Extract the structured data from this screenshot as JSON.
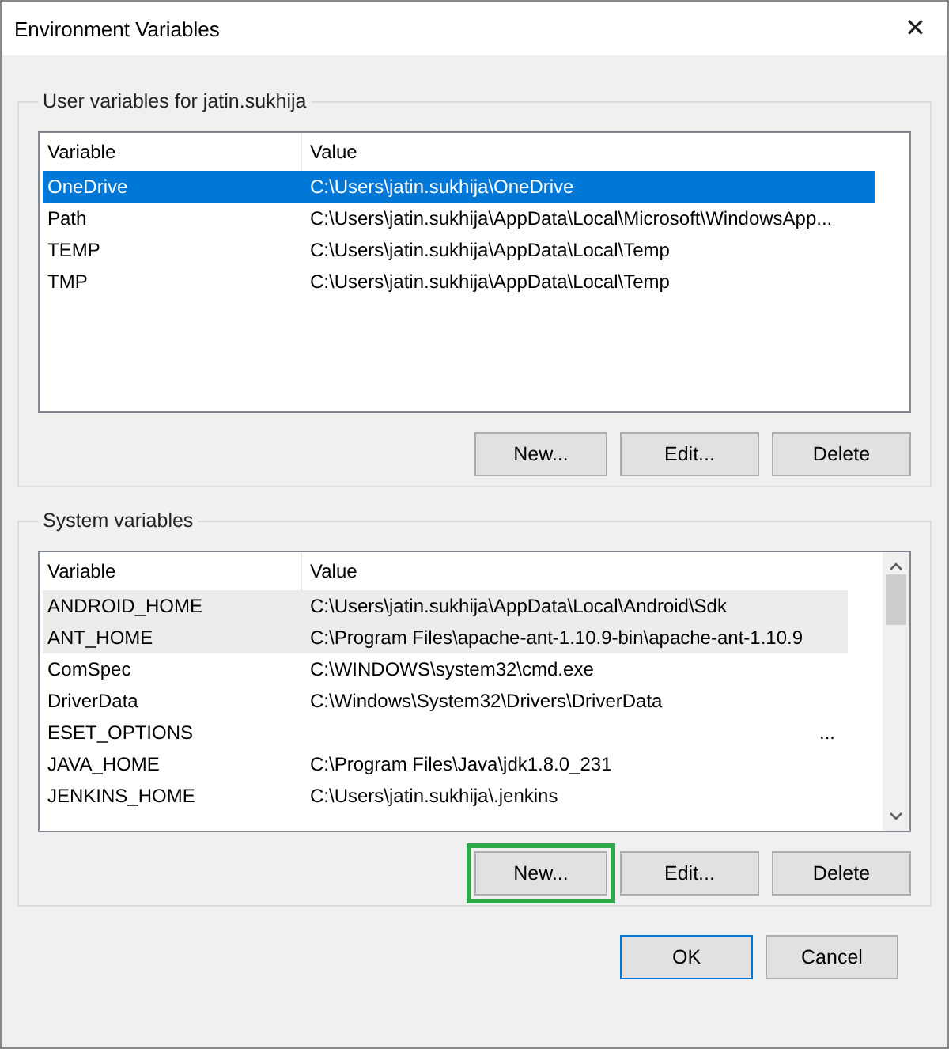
{
  "window": {
    "title": "Environment Variables",
    "close": "✕"
  },
  "user_group": {
    "title": "User variables for jatin.sukhija",
    "columns": [
      "Variable",
      "Value"
    ],
    "rows": [
      {
        "variable": "OneDrive",
        "value": "C:\\Users\\jatin.sukhija\\OneDrive",
        "selected": true
      },
      {
        "variable": "Path",
        "value": "C:\\Users\\jatin.sukhija\\AppData\\Local\\Microsoft\\WindowsApp...",
        "selected": false
      },
      {
        "variable": "TEMP",
        "value": "C:\\Users\\jatin.sukhija\\AppData\\Local\\Temp",
        "selected": false
      },
      {
        "variable": "TMP",
        "value": "C:\\Users\\jatin.sukhija\\AppData\\Local\\Temp",
        "selected": false
      }
    ],
    "buttons": [
      {
        "label": "New...",
        "highlighted": false
      },
      {
        "label": "Edit...",
        "highlighted": false
      },
      {
        "label": "Delete",
        "highlighted": false
      }
    ]
  },
  "system_group": {
    "title": "System variables",
    "columns": [
      "Variable",
      "Value"
    ],
    "rows": [
      {
        "variable": "ANDROID_HOME",
        "value": "C:\\Users\\jatin.sukhija\\AppData\\Local\\Android\\Sdk",
        "selected": true,
        "kind": "plain"
      },
      {
        "variable": "ANT_HOME",
        "value": "C:\\Program Files\\apache-ant-1.10.9-bin\\apache-ant-1.10.9",
        "selected": true,
        "kind": "plain"
      },
      {
        "variable": "ComSpec",
        "value": "C:\\WINDOWS\\system32\\cmd.exe",
        "selected": false,
        "kind": "plain"
      },
      {
        "variable": "DriverData",
        "value": "C:\\Windows\\System32\\Drivers\\DriverData",
        "selected": false,
        "kind": "plain"
      },
      {
        "variable": "ESET_OPTIONS",
        "value": "...",
        "selected": false,
        "kind": "overflow"
      },
      {
        "variable": "JAVA_HOME",
        "value": "C:\\Program Files\\Java\\jdk1.8.0_231",
        "selected": false,
        "kind": "plain"
      },
      {
        "variable": "JENKINS_HOME",
        "value": "C:\\Users\\jatin.sukhija\\.jenkins",
        "selected": false,
        "kind": "plain"
      }
    ],
    "buttons": [
      {
        "label": "New...",
        "highlighted": true
      },
      {
        "label": "Edit...",
        "highlighted": false
      },
      {
        "label": "Delete",
        "highlighted": false
      }
    ]
  },
  "dialog_buttons": [
    {
      "label": "OK",
      "default": true
    },
    {
      "label": "Cancel",
      "default": false
    }
  ]
}
